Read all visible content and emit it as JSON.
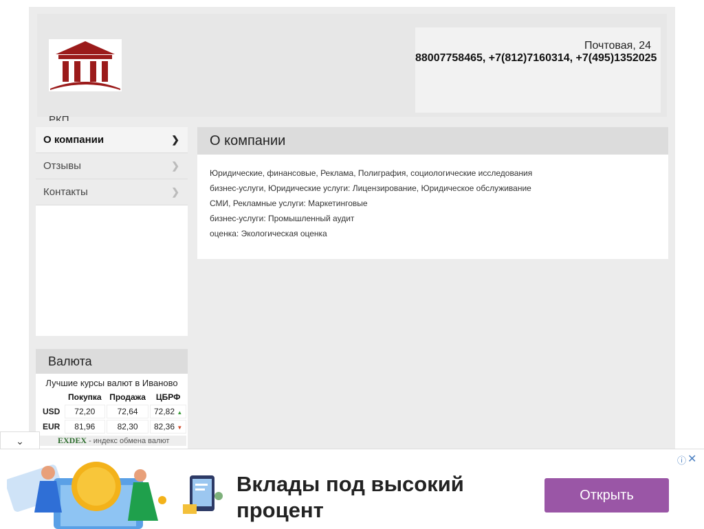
{
  "header": {
    "company_short": "РКП",
    "address": "Почтовая, 24",
    "phones": "88007758465, +7(812)7160314, +7(495)1352025"
  },
  "sidebar": {
    "items": [
      {
        "label": "О компании",
        "active": true
      },
      {
        "label": "Отзывы",
        "active": false
      },
      {
        "label": "Контакты",
        "active": false
      }
    ]
  },
  "main": {
    "title": "О компании",
    "lines": [
      "Юридические, финансовые, Реклама, Полиграфия, социологические исследования",
      "бизнес-услуги, Юридические услуги: Лицензирование, Юридическое обслуживание",
      "СМИ, Рекламные услуги: Маркетинговые",
      "бизнес-услуги: Промышленный аудит",
      "оценка: Экологическая оценка"
    ]
  },
  "currency": {
    "title": "Валюта",
    "subtitle": "Лучшие курсы валют в Иваново",
    "columns": [
      "Покупка",
      "Продажа",
      "ЦБРФ"
    ],
    "rows": [
      {
        "code": "USD",
        "buy": "72,20",
        "sell": "72,64",
        "cbr": "72,82",
        "trend": "up"
      },
      {
        "code": "EUR",
        "buy": "81,96",
        "sell": "82,30",
        "cbr": "82,36",
        "trend": "down"
      }
    ],
    "exdex_brand": "EXDEX",
    "exdex_text": " - индекс обмена валют"
  },
  "ad": {
    "headline": "Вклады под высокий процент",
    "button_label": "Открыть",
    "info_icon": "ⓘ",
    "close_icon": "✕",
    "collapse_icon": "⌄",
    "button_color": "#9a56a6"
  }
}
